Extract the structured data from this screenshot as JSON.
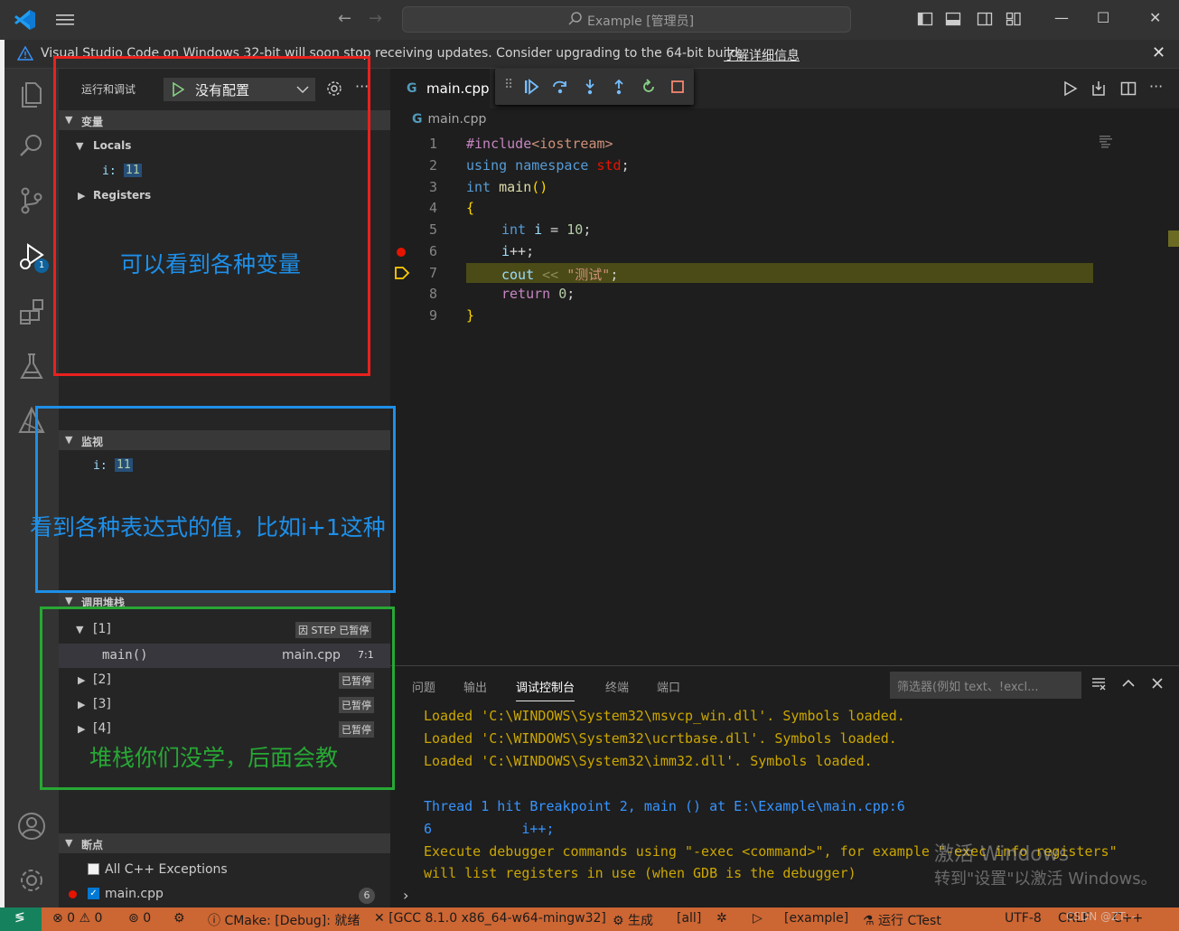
{
  "titlebar": {
    "search_text": "Example [管理员]",
    "nav_back": "←",
    "nav_forward": "→",
    "minimize": "—",
    "maximize": "☐",
    "close": "✕"
  },
  "notification": {
    "message": "Visual Studio Code on Windows 32-bit will soon stop receiving updates. Consider upgrading to the 64-bit build.",
    "link": "了解详细信息",
    "close": "✕"
  },
  "activity_bar": {
    "items": [
      "explorer-icon",
      "search-icon",
      "source-control-icon",
      "run-debug-icon",
      "extensions-icon",
      "testing-icon",
      "cmake-icon",
      "accounts-icon",
      "manage-gear-icon"
    ],
    "debug_badge": "1"
  },
  "sidebar": {
    "run_label": "运行和调试",
    "config": "没有配置",
    "more": "···",
    "variables": {
      "header": "变量",
      "locals_label": "Locals",
      "var_name": "i:",
      "var_value": "11",
      "registers_label": "Registers"
    },
    "watch": {
      "header": "监视",
      "expr_name": "i:",
      "expr_value": "11"
    },
    "callstack": {
      "header": "调用堆栈",
      "threads": [
        {
          "label": "[1]",
          "status": "因 STEP 已暂停",
          "expanded": true
        },
        {
          "label": "[2]",
          "status": "已暂停"
        },
        {
          "label": "[3]",
          "status": "已暂停"
        },
        {
          "label": "[4]",
          "status": "已暂停"
        }
      ],
      "frame": {
        "name": "main()",
        "file": "main.cpp",
        "pos": "7:1"
      }
    },
    "breakpoints": {
      "header": "断点",
      "items": [
        {
          "label": "All C++ Exceptions",
          "checked": false
        },
        {
          "label": "main.cpp",
          "checked": true,
          "line": "6"
        }
      ]
    }
  },
  "editor": {
    "tab": "main.cpp",
    "breadcrumb": "main.cpp",
    "lines": [
      "1",
      "2",
      "3",
      "4",
      "5",
      "6",
      "7",
      "8",
      "9"
    ],
    "code": {
      "l1_a": "#include",
      "l1_b": "<iostream>",
      "l2_a": "using namespace ",
      "l2_b": "std",
      "l2_c": ";",
      "l3_a": "int ",
      "l3_b": "main",
      "l3_c": "()",
      "l4": "{",
      "l5_a": "int ",
      "l5_b": "i",
      "l5_c": " = ",
      "l5_d": "10",
      "l5_e": ";",
      "l6_a": "i",
      "l6_b": "++",
      "l6_c": ";",
      "l7_a": "cout",
      "l7_b": " << ",
      "l7_c": "\"测试\"",
      "l7_d": ";",
      "l8_a": "return ",
      "l8_b": "0",
      "l8_c": ";",
      "l9": "}"
    }
  },
  "panel": {
    "tabs": [
      "问题",
      "输出",
      "调试控制台",
      "终端",
      "端口"
    ],
    "active_tab": "调试控制台",
    "filter_placeholder": "筛选器(例如 text、!excl...",
    "output": [
      "Loaded 'C:\\WINDOWS\\System32\\msvcp_win.dll'. Symbols loaded.",
      "Loaded 'C:\\WINDOWS\\System32\\ucrtbase.dll'. Symbols loaded.",
      "Loaded 'C:\\WINDOWS\\System32\\imm32.dll'. Symbols loaded.",
      "Thread 1 hit Breakpoint 2, main () at E:\\Example\\main.cpp:6",
      "6           i++;",
      "Execute debugger commands using \"-exec <command>\", for example \"-exec info registers\"",
      "will list registers in use (when GDB is the debugger)"
    ],
    "prompt": "›"
  },
  "statusbar": {
    "remote": "≶",
    "problems": "⊗ 0 ⚠ 0",
    "ports": "0",
    "cmake": "CMake: [Debug]: 就绪",
    "kit": "[GCC 8.1.0 x86_64-w64-mingw32]",
    "build": "生成",
    "target": "[all]",
    "launch_target": "[example]",
    "ctest": "运行 CTest",
    "encoding": "UTF-8",
    "eol": "CRLF",
    "lang": "C++"
  },
  "annotations": {
    "variables_note": "可以看到各种变量",
    "watch_note": "看到各种表达式的值，比如i+1这种",
    "stack_note": "堆栈你们没学，后面会教",
    "colors": {
      "red": "#e8211e",
      "blue": "#1e8fe8",
      "green": "#27a834"
    }
  },
  "watermark": {
    "line1": "激活 Windows",
    "line2": "转到\"设置\"以激活 Windows。",
    "credit": "CSDN @ZT-  -"
  }
}
